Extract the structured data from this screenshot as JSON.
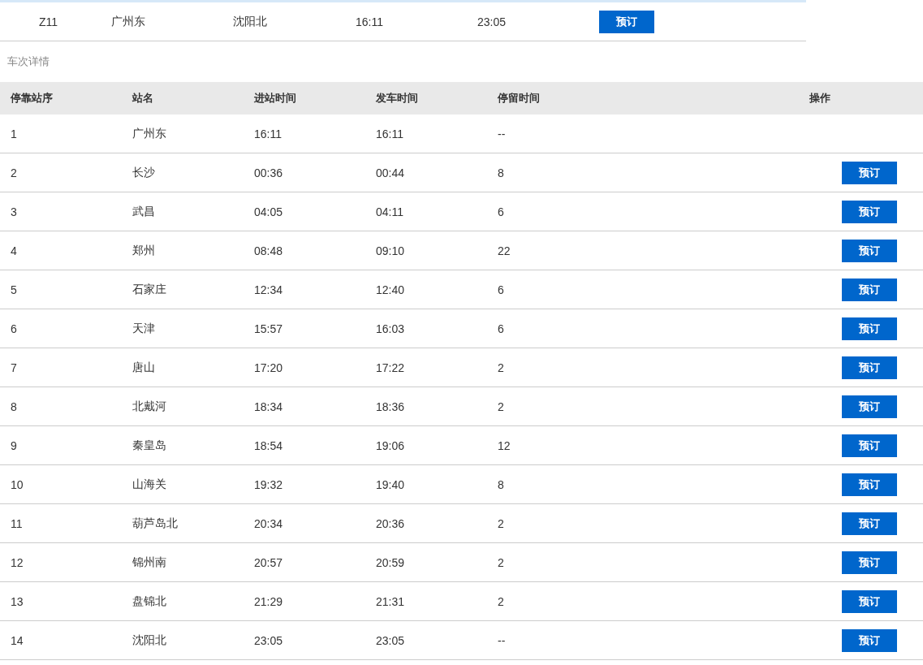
{
  "summary": {
    "train": "Z11",
    "from": "广州东",
    "to": "沈阳北",
    "depart": "16:11",
    "arrive": "23:05",
    "button": "预订"
  },
  "section_title": "车次详情",
  "table": {
    "columns": [
      "停靠站序",
      "站名",
      "进站时间",
      "发车时间",
      "停留时间",
      "操作"
    ],
    "rows": [
      {
        "seq": "1",
        "station": "广州东",
        "arrive": "16:11",
        "depart": "16:11",
        "stay": "--"
      },
      {
        "seq": "2",
        "station": "长沙",
        "arrive": "00:36",
        "depart": "00:44",
        "stay": "8",
        "button": "预订"
      },
      {
        "seq": "3",
        "station": "武昌",
        "arrive": "04:05",
        "depart": "04:11",
        "stay": "6",
        "button": "预订"
      },
      {
        "seq": "4",
        "station": "郑州",
        "arrive": "08:48",
        "depart": "09:10",
        "stay": "22",
        "button": "预订"
      },
      {
        "seq": "5",
        "station": "石家庄",
        "arrive": "12:34",
        "depart": "12:40",
        "stay": "6",
        "button": "预订"
      },
      {
        "seq": "6",
        "station": "天津",
        "arrive": "15:57",
        "depart": "16:03",
        "stay": "6",
        "button": "预订"
      },
      {
        "seq": "7",
        "station": "唐山",
        "arrive": "17:20",
        "depart": "17:22",
        "stay": "2",
        "button": "预订"
      },
      {
        "seq": "8",
        "station": "北戴河",
        "arrive": "18:34",
        "depart": "18:36",
        "stay": "2",
        "button": "预订"
      },
      {
        "seq": "9",
        "station": "秦皇岛",
        "arrive": "18:54",
        "depart": "19:06",
        "stay": "12",
        "button": "预订"
      },
      {
        "seq": "10",
        "station": "山海关",
        "arrive": "19:32",
        "depart": "19:40",
        "stay": "8",
        "button": "预订"
      },
      {
        "seq": "11",
        "station": "葫芦岛北",
        "arrive": "20:34",
        "depart": "20:36",
        "stay": "2",
        "button": "预订"
      },
      {
        "seq": "12",
        "station": "锦州南",
        "arrive": "20:57",
        "depart": "20:59",
        "stay": "2",
        "button": "预订"
      },
      {
        "seq": "13",
        "station": "盘锦北",
        "arrive": "21:29",
        "depart": "21:31",
        "stay": "2",
        "button": "预订"
      },
      {
        "seq": "14",
        "station": "沈阳北",
        "arrive": "23:05",
        "depart": "23:05",
        "stay": "--",
        "button": "预订"
      }
    ]
  }
}
